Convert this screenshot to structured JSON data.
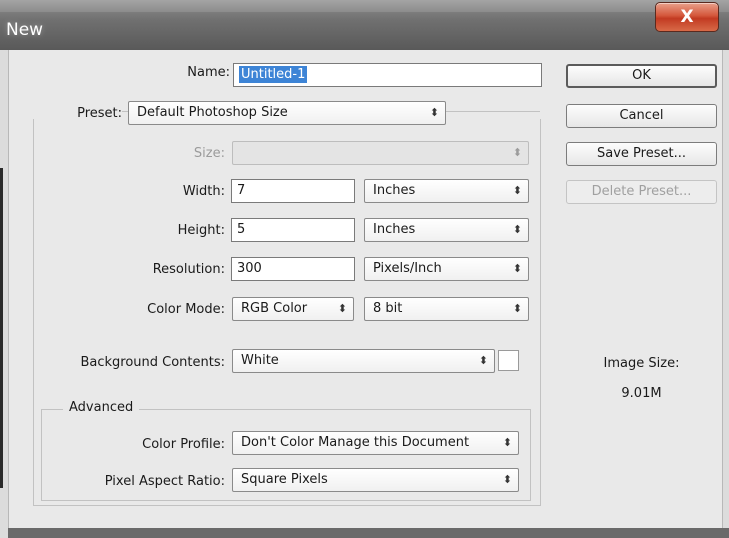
{
  "window": {
    "title": "New",
    "close_glyph": "X"
  },
  "form": {
    "name_label": "Name:",
    "name_value": "Untitled-1",
    "preset_label": "Preset:",
    "preset_value": "Default Photoshop Size",
    "size_label": "Size:",
    "size_value": "",
    "width_label": "Width:",
    "width_value": "7",
    "width_unit": "Inches",
    "height_label": "Height:",
    "height_value": "5",
    "height_unit": "Inches",
    "resolution_label": "Resolution:",
    "resolution_value": "300",
    "resolution_unit": "Pixels/Inch",
    "color_mode_label": "Color Mode:",
    "color_mode_value": "RGB Color",
    "bit_depth_value": "8 bit",
    "background_label": "Background Contents:",
    "background_value": "White",
    "background_swatch_color": "#ffffff",
    "advanced_label": "Advanced",
    "color_profile_label": "Color Profile:",
    "color_profile_value": "Don't Color Manage this Document",
    "pixel_aspect_label": "Pixel Aspect Ratio:",
    "pixel_aspect_value": "Square Pixels",
    "select_arrows": "⬍"
  },
  "buttons": {
    "ok": "OK",
    "cancel": "Cancel",
    "save_preset": "Save Preset...",
    "delete_preset": "Delete Preset..."
  },
  "image_size": {
    "label": "Image Size:",
    "value": "9.01M"
  },
  "colors": {
    "selection": "#3d84d6",
    "close_button": "#c23a22"
  }
}
